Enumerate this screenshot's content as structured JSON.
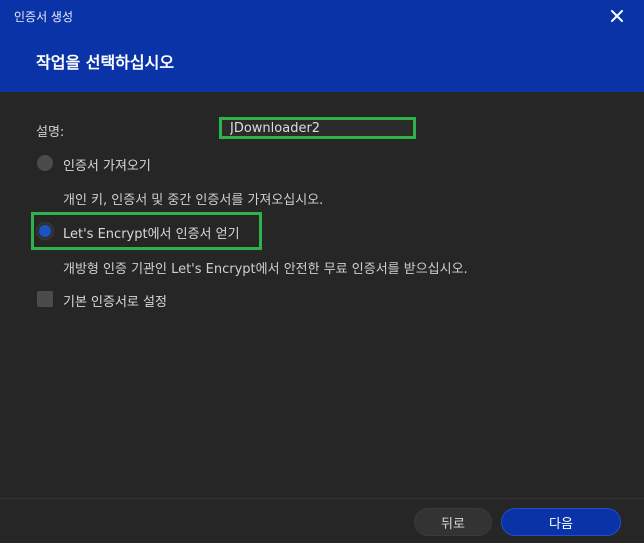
{
  "window": {
    "title": "인증서 생성",
    "close_icon": "close-icon"
  },
  "header": {
    "title": "작업을 선택하십시오"
  },
  "form": {
    "description_label": "설명:",
    "description_value": "JDownloader2"
  },
  "options": [
    {
      "label": "인증서 가져오기",
      "description": "개인 키, 인증서 및 중간 인증서를 가져오십시오.",
      "selected": false
    },
    {
      "label": "Let's Encrypt에서 인증서 얻기",
      "description": "개방형 인증 기관인 Let's Encrypt에서 안전한 무료 인증서를 받으십시오.",
      "selected": true
    }
  ],
  "checkbox": {
    "label": "기본 인증서로 설정",
    "checked": false
  },
  "footer": {
    "back_label": "뒤로",
    "next_label": "다음"
  },
  "colors": {
    "header_bg": "#0a33a8",
    "body_bg": "#262626",
    "highlight": "#2fb24a",
    "radio_selected": "#1854c4"
  }
}
